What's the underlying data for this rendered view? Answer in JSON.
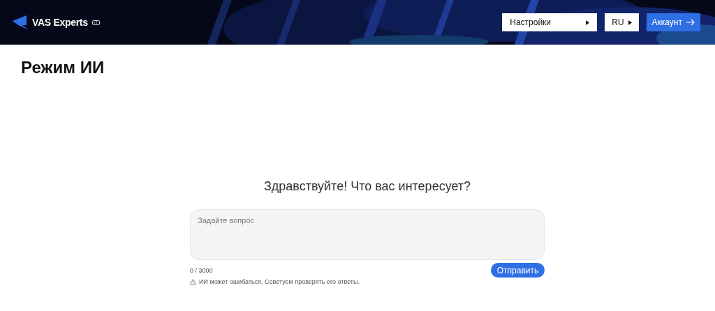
{
  "header": {
    "logo": "VAS Experts",
    "settings_button": "Настройки",
    "language_button": "RU",
    "account_button": "Аккаунт"
  },
  "page": {
    "title": "Режим ИИ"
  },
  "chat": {
    "greeting": "Здравствуйте! Что вас интересует?",
    "placeholder": "Задайте вопрос",
    "counter": "0 / 3000",
    "send_button": "Отправить",
    "disclaimer": "ИИ может ошибаться. Советуем проверять его ответы."
  }
}
